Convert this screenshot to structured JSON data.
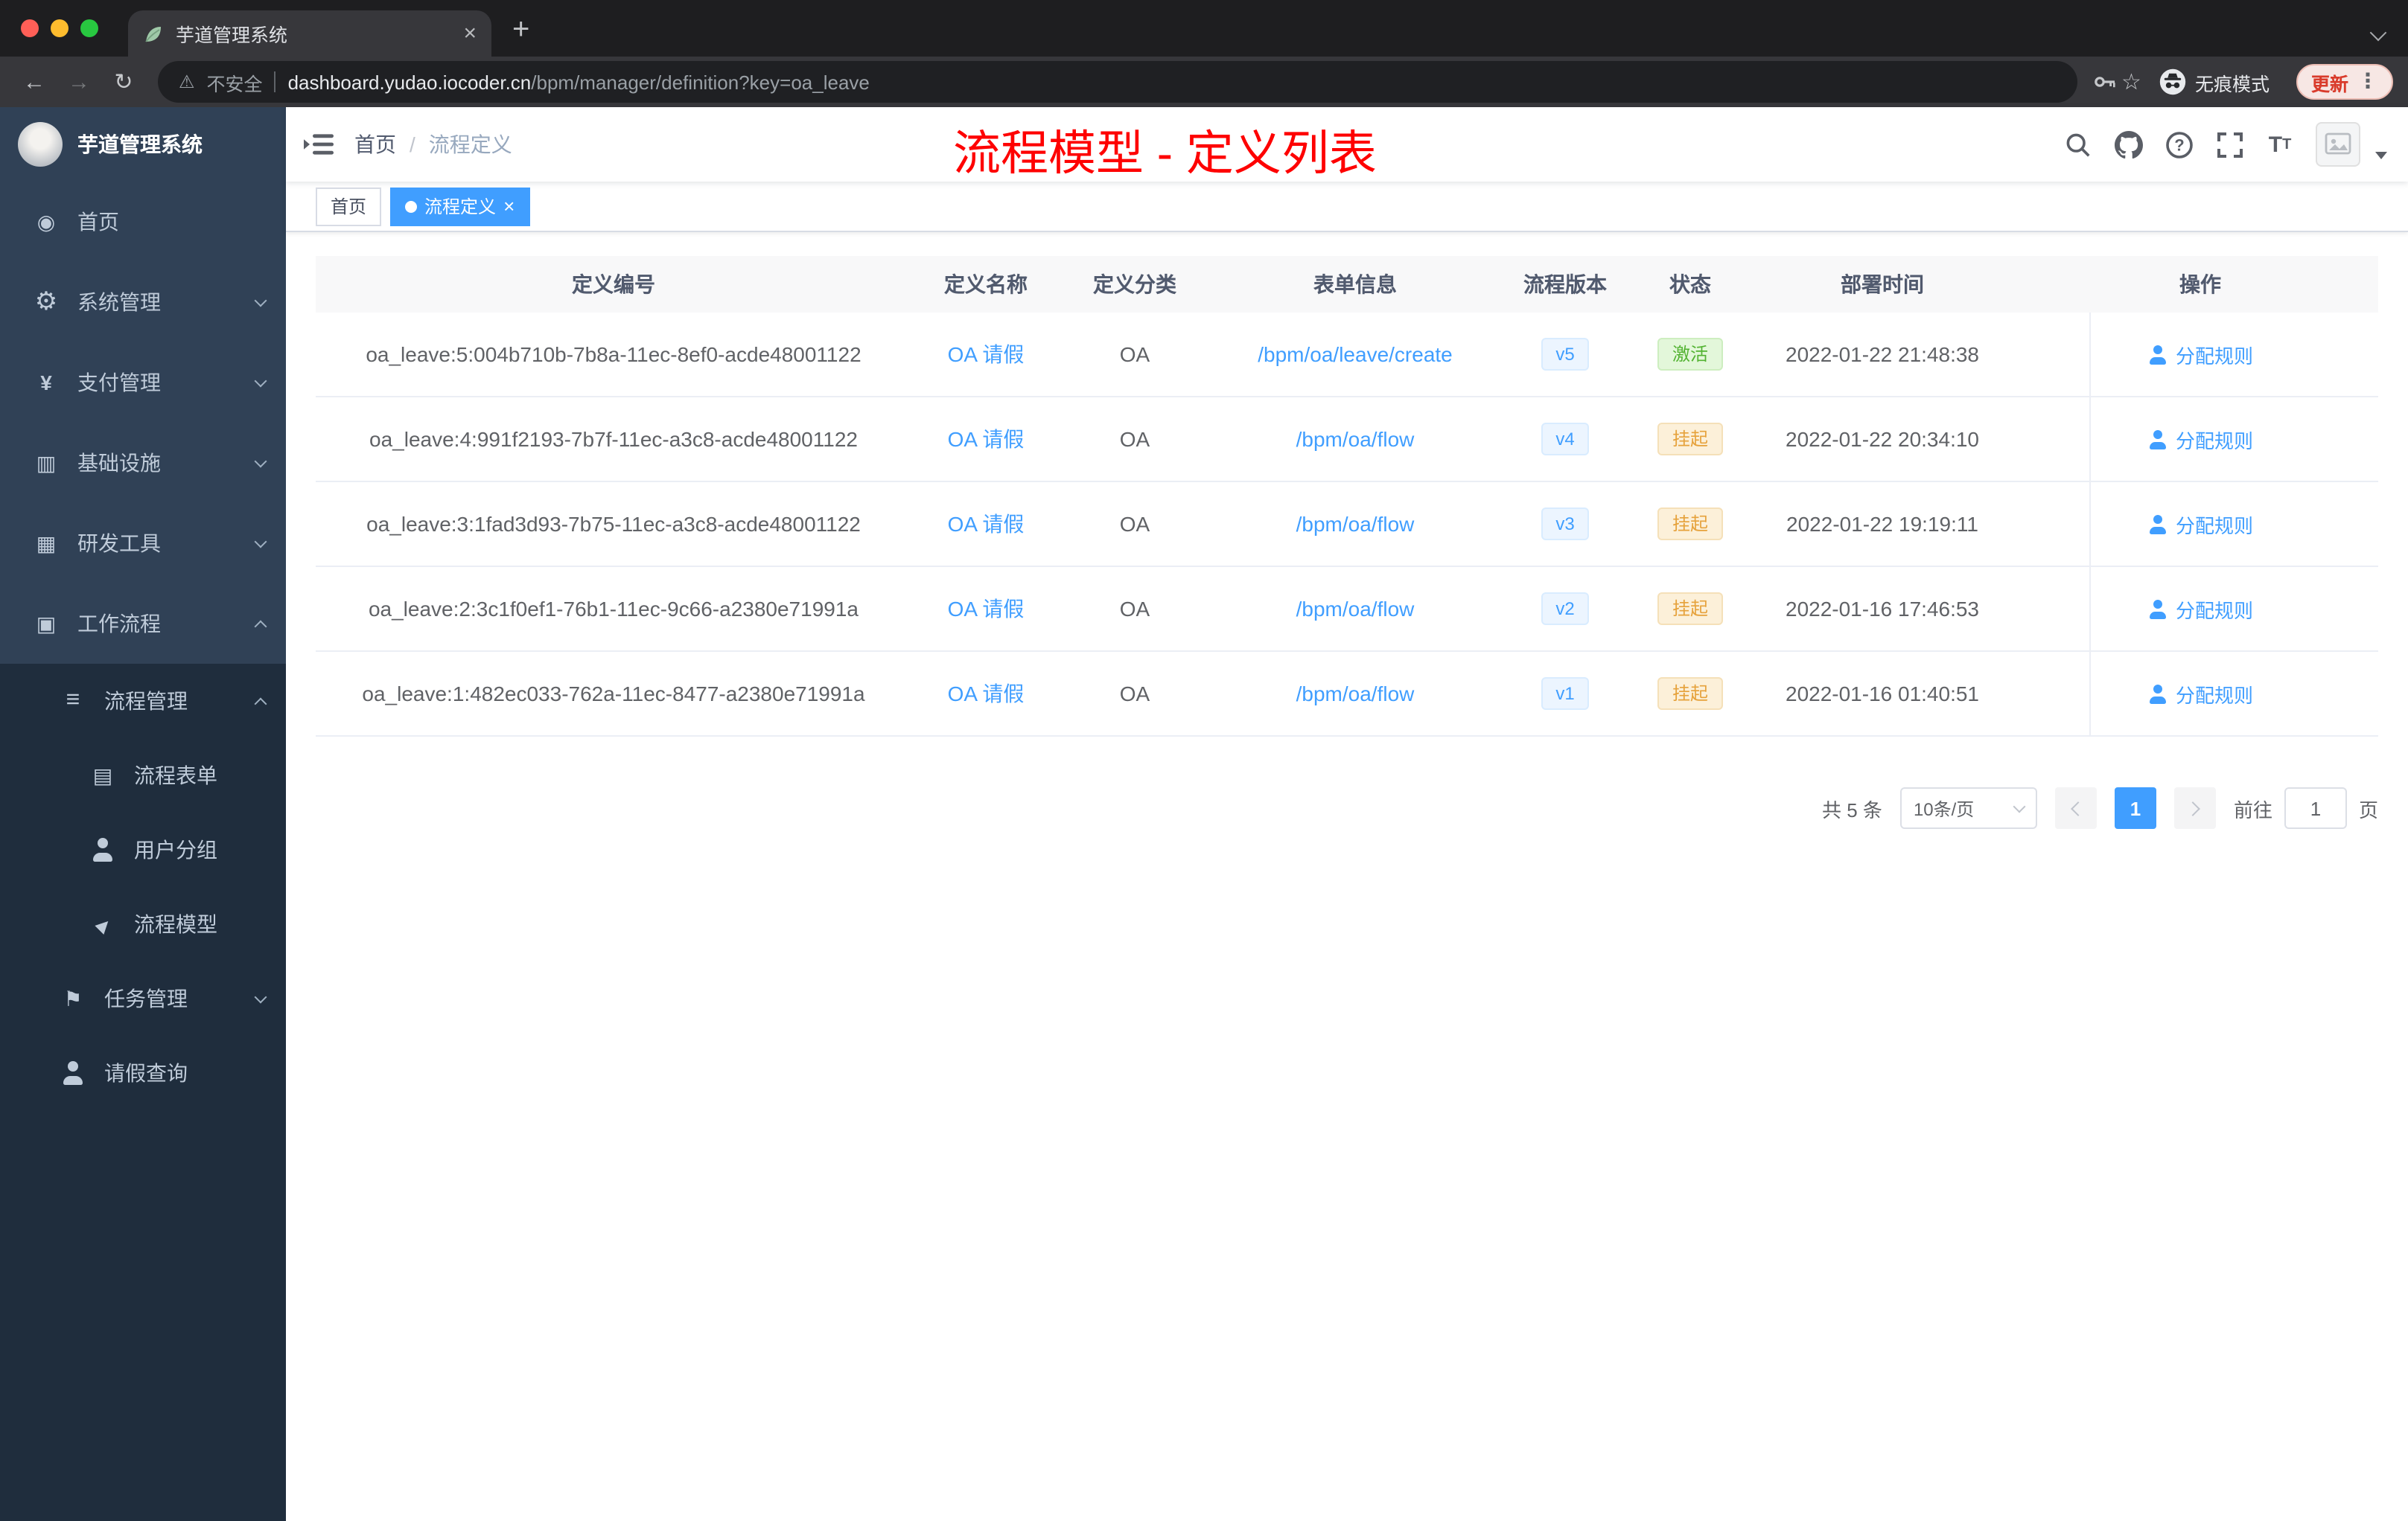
{
  "colors": {
    "accent": "#409eff",
    "annotation_red": "#fe0000",
    "sidebar_bg": "#304156",
    "submenu_bg": "#1f2d3d",
    "traffic_close": "#ff5f57",
    "traffic_minimize": "#febc2e",
    "traffic_zoom": "#28c840"
  },
  "browser": {
    "tab_title": "芋道管理系统",
    "security_label": "不安全",
    "url_host": "dashboard.yudao.iocoder.cn",
    "url_path": "/bpm/manager/definition?key=oa_leave",
    "incognito_label": "无痕模式",
    "update_label": "更新"
  },
  "sidebar": {
    "logo_title": "芋道管理系统",
    "top_items": [
      {
        "label": "首页",
        "icon": "dashboard-icon",
        "chevron": ""
      },
      {
        "label": "系统管理",
        "icon": "gear-icon",
        "chevron": "down"
      },
      {
        "label": "支付管理",
        "icon": "yen-icon",
        "chevron": "down"
      },
      {
        "label": "基础设施",
        "icon": "infra-icon",
        "chevron": "down"
      },
      {
        "label": "研发工具",
        "icon": "tools-icon",
        "chevron": "down"
      },
      {
        "label": "工作流程",
        "icon": "workflow-icon",
        "chevron": "up"
      }
    ],
    "sub_items": [
      {
        "label": "流程管理",
        "icon": "list-icon",
        "chevron": "up",
        "level": "2"
      },
      {
        "label": "流程表单",
        "icon": "form-icon",
        "chevron": "",
        "level": "3"
      },
      {
        "label": "用户分组",
        "icon": "user-group-icon",
        "chevron": "",
        "level": "3"
      },
      {
        "label": "流程模型",
        "icon": "send-icon",
        "chevron": "",
        "level": "3"
      },
      {
        "label": "任务管理",
        "icon": "task-icon",
        "chevron": "down",
        "level": "2"
      },
      {
        "label": "请假查询",
        "icon": "user-icon",
        "chevron": "",
        "level": "2"
      }
    ]
  },
  "header": {
    "breadcrumb_home": "首页",
    "breadcrumb_separator": "/",
    "breadcrumb_current": "流程定义",
    "annotation": "流程模型 - 定义列表"
  },
  "tags": {
    "home": "首页",
    "active": "流程定义"
  },
  "table": {
    "columns": [
      "定义编号",
      "定义名称",
      "定义分类",
      "表单信息",
      "流程版本",
      "状态",
      "部署时间",
      "操作"
    ],
    "rows": [
      {
        "id": "oa_leave:5:004b710b-7b8a-11ec-8ef0-acde48001122",
        "name": "OA 请假",
        "category": "OA",
        "form": "/bpm/oa/leave/create",
        "version": "v5",
        "status": "激活",
        "status_type": "success",
        "time": "2022-01-22 21:48:38",
        "action": "分配规则"
      },
      {
        "id": "oa_leave:4:991f2193-7b7f-11ec-a3c8-acde48001122",
        "name": "OA 请假",
        "category": "OA",
        "form": "/bpm/oa/flow",
        "version": "v4",
        "status": "挂起",
        "status_type": "warning",
        "time": "2022-01-22 20:34:10",
        "action": "分配规则"
      },
      {
        "id": "oa_leave:3:1fad3d93-7b75-11ec-a3c8-acde48001122",
        "name": "OA 请假",
        "category": "OA",
        "form": "/bpm/oa/flow",
        "version": "v3",
        "status": "挂起",
        "status_type": "warning",
        "time": "2022-01-22 19:19:11",
        "action": "分配规则"
      },
      {
        "id": "oa_leave:2:3c1f0ef1-76b1-11ec-9c66-a2380e71991a",
        "name": "OA 请假",
        "category": "OA",
        "form": "/bpm/oa/flow",
        "version": "v2",
        "status": "挂起",
        "status_type": "warning",
        "time": "2022-01-16 17:46:53",
        "action": "分配规则"
      },
      {
        "id": "oa_leave:1:482ec033-762a-11ec-8477-a2380e71991a",
        "name": "OA 请假",
        "category": "OA",
        "form": "/bpm/oa/flow",
        "version": "v1",
        "status": "挂起",
        "status_type": "warning",
        "time": "2022-01-16 01:40:51",
        "action": "分配规则"
      }
    ]
  },
  "pagination": {
    "total": "共 5 条",
    "page_size": "10条/页",
    "current_page": "1",
    "goto_label": "前往",
    "goto_value": "1",
    "page_unit": "页"
  }
}
